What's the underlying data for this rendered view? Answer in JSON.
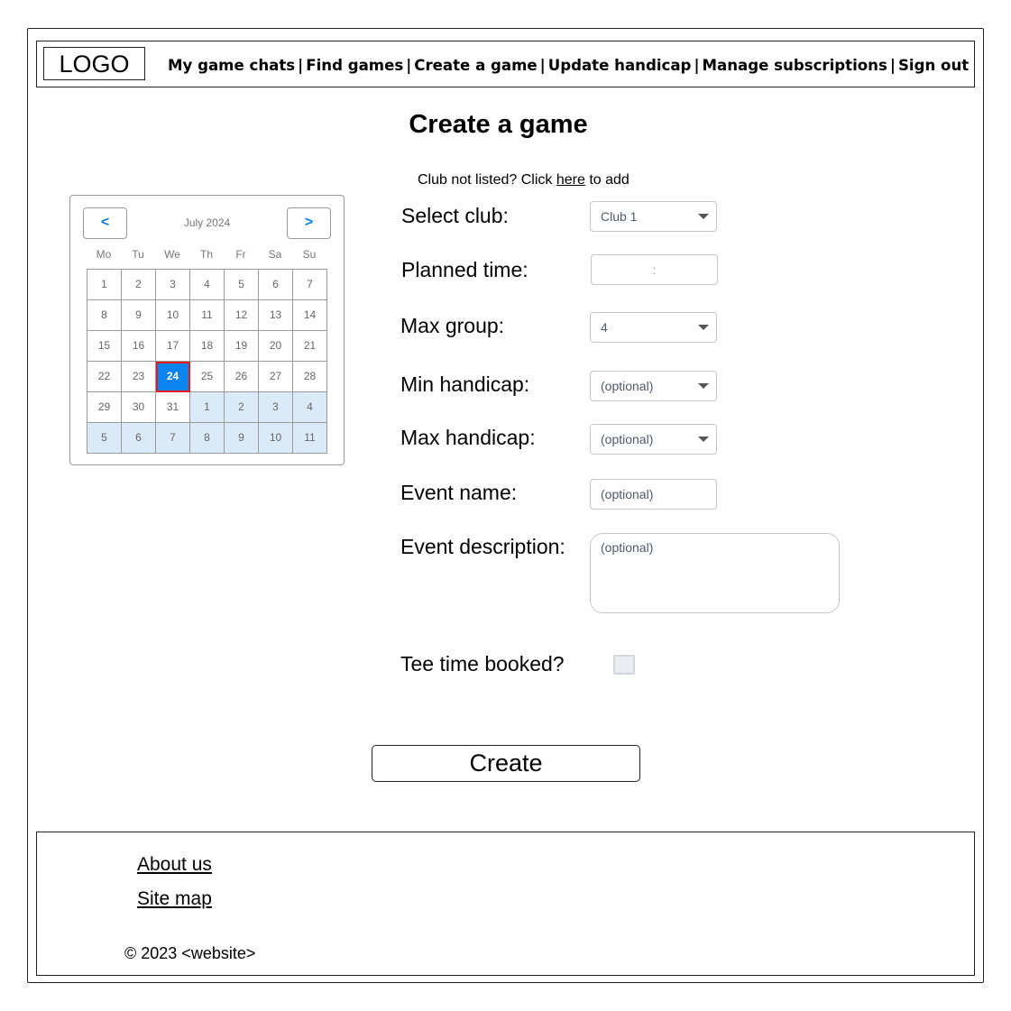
{
  "header": {
    "logo": "LOGO",
    "nav": [
      "My game chats",
      "Find games",
      "Create a game",
      "Update handicap",
      "Manage subscriptions",
      "Sign out"
    ],
    "separator": "|"
  },
  "page": {
    "title": "Create a game",
    "club_note_prefix": "Club not listed? Click ",
    "club_note_link": "here",
    "club_note_suffix": " to add"
  },
  "calendar": {
    "month": "July 2024",
    "prev": "<",
    "next": ">",
    "weekdays": [
      "Mo",
      "Tu",
      "We",
      "Th",
      "Fr",
      "Sa",
      "Su"
    ],
    "days": [
      "1",
      "2",
      "3",
      "4",
      "5",
      "6",
      "7",
      "8",
      "9",
      "10",
      "11",
      "12",
      "13",
      "14",
      "15",
      "16",
      "17",
      "18",
      "19",
      "20",
      "21",
      "22",
      "23",
      "24",
      "25",
      "26",
      "27",
      "28",
      "29",
      "30",
      "31",
      "1",
      "2",
      "3",
      "4",
      "5",
      "6",
      "7",
      "8",
      "9",
      "10",
      "11"
    ],
    "selected": "24",
    "selected_color": "#0a84f0",
    "next_month_color": "#dbeaf8"
  },
  "form": {
    "club_label": "Select club:",
    "club_value": "Club 1",
    "time_label": "Planned time:",
    "time_value": ":",
    "group_label": "Max group:",
    "group_value": "4",
    "min_label": "Min handicap:",
    "min_placeholder": "(optional)",
    "max_label": "Max handicap:",
    "max_placeholder": "(optional)",
    "event_label": "Event name:",
    "event_placeholder": "(optional)",
    "desc_label": "Event description:",
    "desc_placeholder": "(optional)",
    "tee_label": "Tee time booked?",
    "tee_checked": false,
    "create_label": "Create"
  },
  "footer": {
    "about": "About us",
    "sitemap": "Site map",
    "copyright": "© 2023 <website>"
  }
}
